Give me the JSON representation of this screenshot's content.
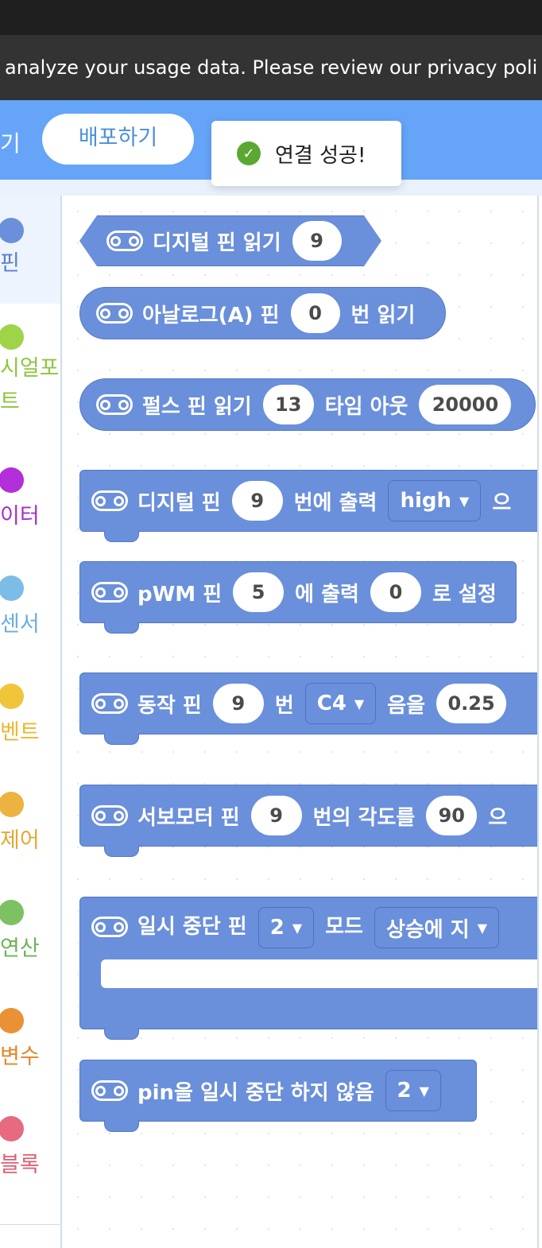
{
  "banner": {
    "text": "analyze your usage data. Please review our privacy poli"
  },
  "toolbar": {
    "prev_label": "기",
    "deploy_label": "배포하기"
  },
  "toast": {
    "icon": "check-icon",
    "message": "연결 성공!"
  },
  "sidebar": {
    "categories": [
      {
        "label": "핀",
        "color": "#6b8fdb",
        "text_color": "#5b7fcf"
      },
      {
        "label": "시얼포",
        "label2": "트",
        "color": "#9ed448",
        "text_color": "#8cc63f"
      },
      {
        "label": "이터",
        "color": "#b22fd9",
        "text_color": "#a52fcc"
      },
      {
        "label": "센서",
        "color": "#7bbde7",
        "text_color": "#6aaee0"
      },
      {
        "label": "벤트",
        "color": "#f0c53a",
        "text_color": "#e8b92e"
      },
      {
        "label": "제어",
        "color": "#ecb340",
        "text_color": "#e5a836"
      },
      {
        "label": "연산",
        "color": "#7dc164",
        "text_color": "#6cb456"
      },
      {
        "label": "변수",
        "color": "#ea9135",
        "text_color": "#e3862a"
      },
      {
        "label": "블록",
        "color": "#e76b80",
        "text_color": "#de5f74"
      }
    ]
  },
  "blocks": {
    "digital_read": {
      "label": "디지털 핀 읽기",
      "pin": "9"
    },
    "analog_read": {
      "label": "아날로그(A) 핀",
      "pin": "0",
      "suffix": "번 읽기"
    },
    "pulse_read": {
      "label": "펄스 핀 읽기",
      "pin": "13",
      "mid": "타임 아웃",
      "timeout": "20000"
    },
    "digital_write": {
      "label": "디지털 핀",
      "pin": "9",
      "mid": "번에 출력",
      "value": "high",
      "suffix": "으"
    },
    "pwm_write": {
      "label": "pWM 핀",
      "pin": "5",
      "mid": "에 출력",
      "value": "0",
      "suffix": "로 설정"
    },
    "tone": {
      "label": "동작 핀",
      "pin": "9",
      "mid": "번",
      "note": "C4",
      "mid2": "음을",
      "beat": "0.25"
    },
    "servo": {
      "label": "서보모터 핀",
      "pin": "9",
      "mid": "번의 각도를",
      "angle": "90",
      "suffix": "으"
    },
    "interrupt": {
      "label": "일시 중단 핀",
      "pin": "2",
      "mid": "모드",
      "mode": "상승에 지"
    },
    "detach": {
      "label": "pin을 일시 중단 하지 않음",
      "pin": "2"
    }
  }
}
